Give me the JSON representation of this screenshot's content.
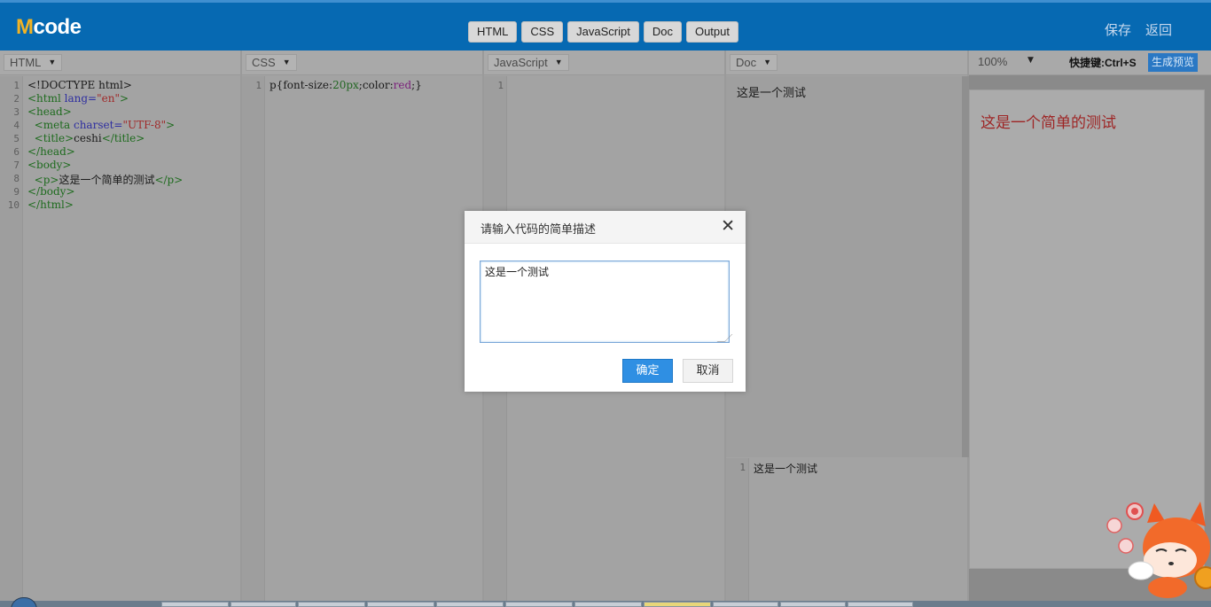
{
  "header": {
    "logo_first": "M",
    "logo_rest": "code",
    "tabs": [
      "HTML",
      "CSS",
      "JavaScript",
      "Doc",
      "Output"
    ],
    "save_label": "保存",
    "back_label": "返回"
  },
  "panels": {
    "html": {
      "selector": "HTML",
      "line_numbers": [
        "1",
        "2",
        "3",
        "4",
        "5",
        "6",
        "7",
        "8",
        "9",
        "10"
      ]
    },
    "css": {
      "selector": "CSS",
      "line_numbers": [
        "1"
      ]
    },
    "js": {
      "selector": "JavaScript",
      "line_numbers": [
        "1"
      ]
    },
    "doc": {
      "selector": "Doc",
      "preview_text": "这是一个测试",
      "line_numbers": [
        "1"
      ],
      "code": "这是一个测试"
    },
    "output": {
      "zoom": "100%",
      "shortcut": "快捷键:Ctrl+S",
      "generate_label": "生成预览",
      "rendered_text": "这是一个简单的测试"
    }
  },
  "dialog": {
    "title": "请输入代码的简单描述",
    "close_glyph": "✕",
    "input_value": "这是一个测试",
    "ok_label": "确定",
    "cancel_label": "取消"
  },
  "colors": {
    "header_bg": "#0669b2",
    "logo_accent": "#f2b324",
    "primary_button": "#2f8fe3",
    "output_text": "#9e2525"
  },
  "icons": {
    "caret": "chevron-down-icon",
    "close": "close-icon",
    "mascot": "fox-mascot-icon"
  }
}
